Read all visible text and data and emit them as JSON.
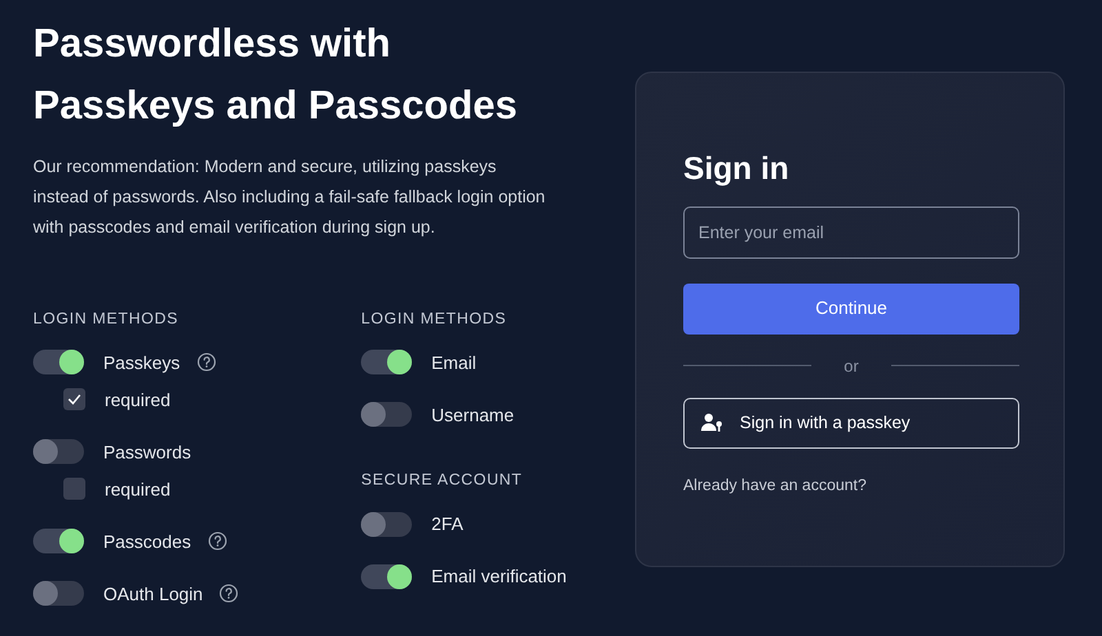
{
  "heading": {
    "line_1": "Passwordless with",
    "line_2": "Passkeys and Passcodes"
  },
  "description": "Our recommendation: Modern and secure, utilizing passkeys instead of passwords. Also including a fail-safe fallback login option with passcodes and email verification during sign up.",
  "columns": [
    {
      "sections": [
        {
          "title": "LOGIN METHODS",
          "items": [
            {
              "label": "Passkeys",
              "on": true,
              "help": true,
              "required": {
                "label": "required",
                "checked": true
              }
            },
            {
              "label": "Passwords",
              "on": false,
              "help": false,
              "required": {
                "label": "required",
                "checked": false
              }
            },
            {
              "label": "Passcodes",
              "on": true,
              "help": true
            },
            {
              "label": "OAuth Login",
              "on": false,
              "help": true
            }
          ]
        }
      ]
    },
    {
      "sections": [
        {
          "title": "LOGIN METHODS",
          "items": [
            {
              "label": "Email",
              "on": true,
              "help": false
            },
            {
              "label": "Username",
              "on": false,
              "help": false
            }
          ]
        },
        {
          "title": "SECURE ACCOUNT",
          "items": [
            {
              "label": "2FA",
              "on": false,
              "help": false
            },
            {
              "label": "Email verification",
              "on": true,
              "help": false
            }
          ]
        }
      ]
    }
  ],
  "signin": {
    "title": "Sign in",
    "email": {
      "placeholder": "Enter your email"
    },
    "continue": "Continue",
    "divider": "or",
    "passkey_button": "Sign in with a passkey",
    "account_link": "Already have an account?"
  }
}
